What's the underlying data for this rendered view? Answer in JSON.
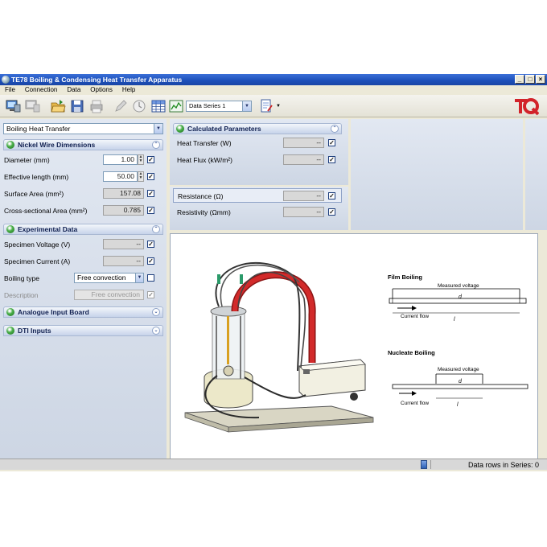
{
  "window": {
    "title": "TE78 Boiling & Condensing Heat Transfer Apparatus",
    "buttons": [
      "_",
      "□",
      "×"
    ]
  },
  "menu": [
    "File",
    "Connection",
    "Data",
    "Options",
    "Help"
  ],
  "toolbar": {
    "series_select": "Data Series 1",
    "icons": [
      "computer-icon",
      "computer-disabled-icon",
      "open-folder-icon",
      "save-icon",
      "print-icon",
      "pen-icon",
      "clock-icon",
      "table-icon",
      "chart-icon",
      "series-dropdown",
      "wizard-icon"
    ],
    "logo": "TQ"
  },
  "left": {
    "mode": "Boiling Heat Transfer",
    "nickel": {
      "header": "Nickel Wire Dimensions",
      "diameter": {
        "label": "Diameter  (mm)",
        "value": "1.00"
      },
      "effective_length": {
        "label": "Effective length  (mm)",
        "value": "50.00"
      },
      "surface_area": {
        "label": "Surface Area  (mm²)",
        "value": "157.08"
      },
      "cross_sectional": {
        "label": "Cross-sectional Area  (mm²)",
        "value": "0.785"
      }
    },
    "experimental": {
      "header": "Experimental Data",
      "voltage": {
        "label": "Specimen Voltage  (V)",
        "value": "--"
      },
      "current": {
        "label": "Specimen Current  (A)",
        "value": "--"
      },
      "boiling_type": {
        "label": "Boiling type",
        "value": "Free convection"
      },
      "description": {
        "label": "Description",
        "value": "Free convection"
      }
    },
    "analogue": {
      "header": "Analogue Input Board"
    },
    "dti": {
      "header": "DTI Inputs"
    }
  },
  "calculated": {
    "header": "Calculated Parameters",
    "heat_transfer": {
      "label": "Heat Transfer  (W)",
      "value": "--"
    },
    "heat_flux": {
      "label": "Heat Flux  (kW/m²)",
      "value": "--"
    },
    "resistance": {
      "label": "Resistance  (Ω)",
      "value": "--"
    },
    "resistivity": {
      "label": "Resistivity  (Ωmm)",
      "value": "--"
    }
  },
  "diagram": {
    "film_title": "Film Boiling",
    "film_measured": "Measured voltage",
    "film_current": "Current flow",
    "nucleate_title": "Nucleate Boiling",
    "nucleate_measured": "Measured voltage",
    "nucleate_current": "Current flow",
    "d_label": "d",
    "l_label": "l"
  },
  "status": {
    "text": "Data rows in Series: 0"
  },
  "colors": {
    "titlebar": "#1c4fb8",
    "panel": "#d9dfe8",
    "accent_red": "#c0211f"
  }
}
